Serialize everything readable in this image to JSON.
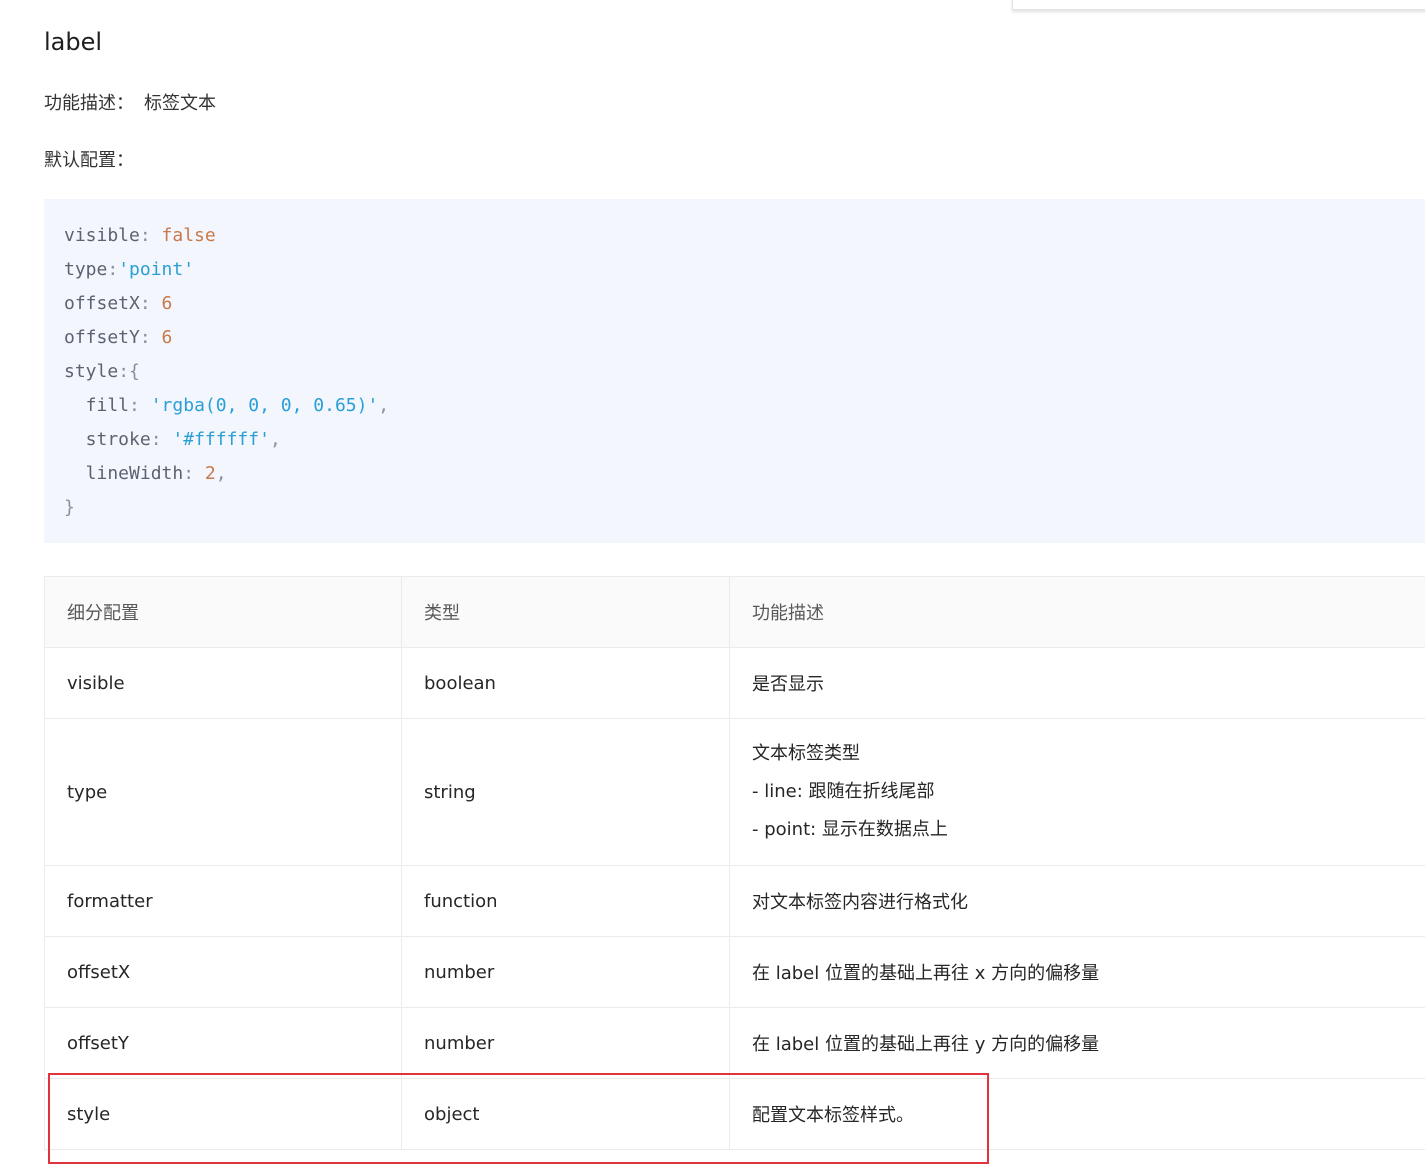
{
  "section": {
    "title": "label",
    "description_label": "功能描述：",
    "description_value": "标签文本",
    "default_config_label": "默认配置："
  },
  "code_lines": [
    [
      {
        "t": "visible",
        "c": "key"
      },
      {
        "t": ": ",
        "c": "punc"
      },
      {
        "t": "false",
        "c": "bool"
      }
    ],
    [
      {
        "t": "type",
        "c": "key"
      },
      {
        "t": ":",
        "c": "punc"
      },
      {
        "t": "'point'",
        "c": "str"
      }
    ],
    [
      {
        "t": "offsetX",
        "c": "key"
      },
      {
        "t": ": ",
        "c": "punc"
      },
      {
        "t": "6",
        "c": "num"
      }
    ],
    [
      {
        "t": "offsetY",
        "c": "key"
      },
      {
        "t": ": ",
        "c": "punc"
      },
      {
        "t": "6",
        "c": "num"
      }
    ],
    [
      {
        "t": "style",
        "c": "key"
      },
      {
        "t": ":{",
        "c": "punc"
      }
    ],
    [
      {
        "t": "  fill",
        "c": "key"
      },
      {
        "t": ": ",
        "c": "punc"
      },
      {
        "t": "'rgba(0, 0, 0, 0.65)'",
        "c": "str"
      },
      {
        "t": ",",
        "c": "punc"
      }
    ],
    [
      {
        "t": "  stroke",
        "c": "key"
      },
      {
        "t": ": ",
        "c": "punc"
      },
      {
        "t": "'#ffffff'",
        "c": "str"
      },
      {
        "t": ",",
        "c": "punc"
      }
    ],
    [
      {
        "t": "  lineWidth",
        "c": "key"
      },
      {
        "t": ": ",
        "c": "punc"
      },
      {
        "t": "2",
        "c": "num"
      },
      {
        "t": ",",
        "c": "punc"
      }
    ],
    [
      {
        "t": "}",
        "c": "punc"
      }
    ]
  ],
  "table": {
    "headers": [
      "细分配置",
      "类型",
      "功能描述"
    ],
    "rows": [
      {
        "name": "visible",
        "type": "boolean",
        "desc": [
          "是否显示"
        ]
      },
      {
        "name": "type",
        "type": "string",
        "desc": [
          "文本标签类型",
          "- line: 跟随在折线尾部",
          "- point: 显示在数据点上"
        ]
      },
      {
        "name": "formatter",
        "type": "function",
        "desc": [
          "对文本标签内容进行格式化"
        ]
      },
      {
        "name": "offsetX",
        "type": "number",
        "desc": [
          "在 label 位置的基础上再往 x 方向的偏移量"
        ]
      },
      {
        "name": "offsetY",
        "type": "number",
        "desc": [
          "在 label 位置的基础上再往 y 方向的偏移量"
        ]
      },
      {
        "name": "style",
        "type": "object",
        "desc": [
          "配置文本标签样式。"
        ]
      }
    ]
  },
  "colors": {
    "highlight_border": "#e0333b",
    "code_background": "#f3f6fd",
    "string_token": "#2a9fd6",
    "number_token": "#c8794b"
  }
}
